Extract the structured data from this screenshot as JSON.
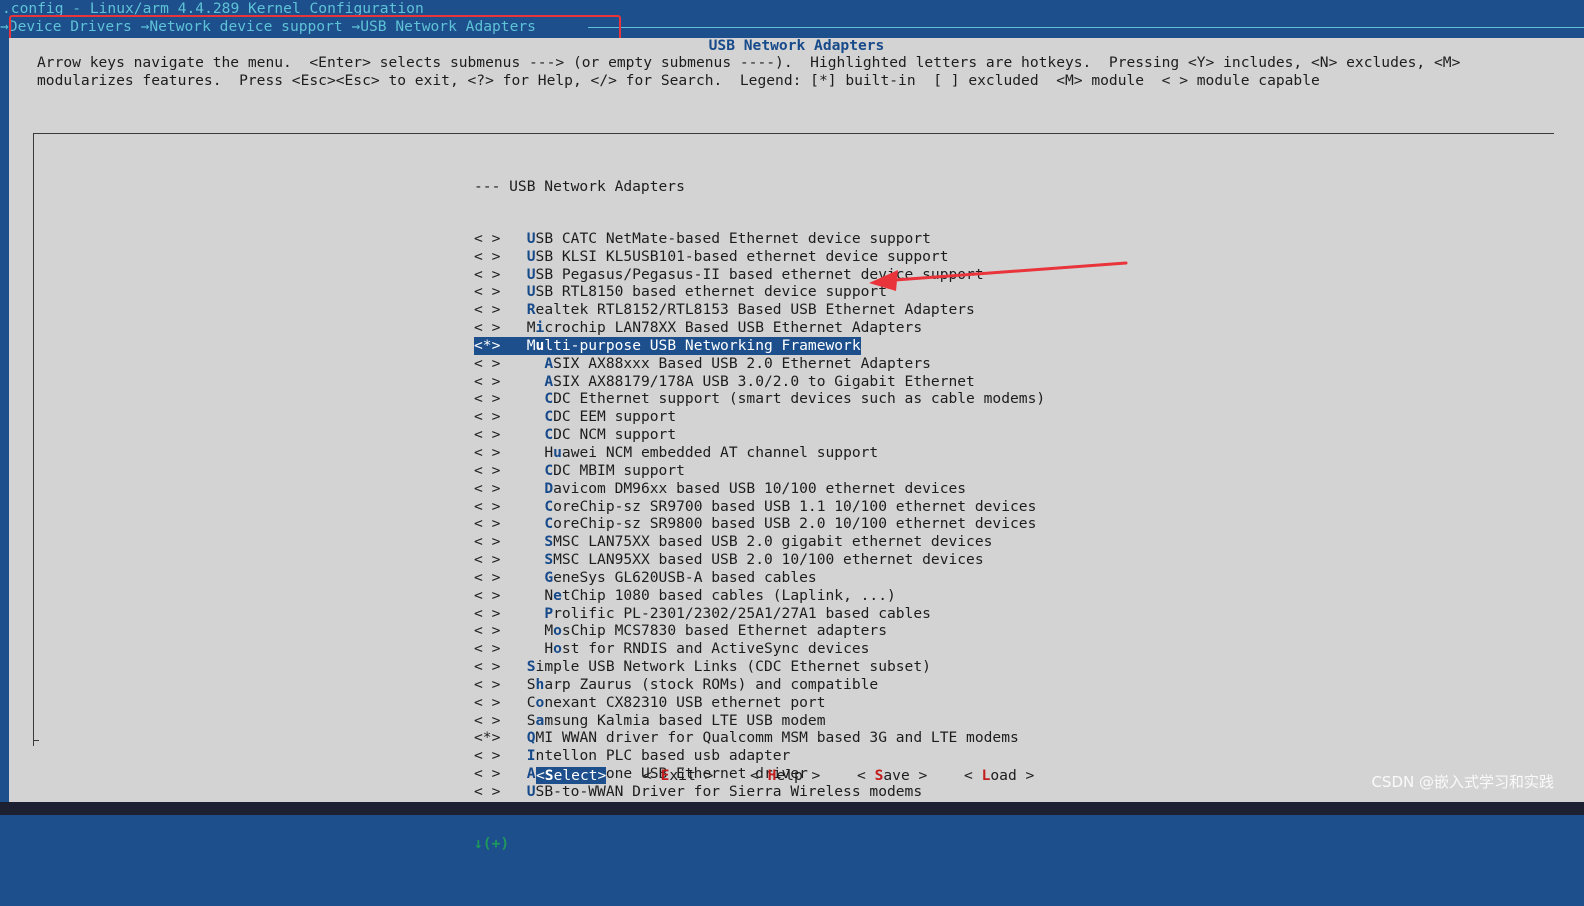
{
  "window": {
    "title": ".config - Linux/arm 4.4.289 Kernel Configuration",
    "breadcrumb": "→Device Drivers →Network device support →USB Network Adapters",
    "annotation_color": "#e8343a"
  },
  "panel": {
    "title": "USB Network Adapters",
    "help_lines": [
      "Arrow keys navigate the menu.  <Enter> selects submenus ---> (or empty submenus ----).  Highlighted letters are hotkeys.  Pressing <Y> includes, <N> excludes, <M>",
      "modularizes features.  Press <Esc><Esc> to exit, <?> for Help, </> for Search.  Legend: [*] built-in  [ ] excluded  <M> module  < > module capable"
    ]
  },
  "menu": {
    "header": "--- USB Network Adapters",
    "items": [
      {
        "state": "< >",
        "indent": "  ",
        "hotkey": "U",
        "rest": "SB CATC NetMate-based Ethernet device support"
      },
      {
        "state": "< >",
        "indent": "  ",
        "hotkey": "U",
        "rest": "SB KLSI KL5USB101-based ethernet device support"
      },
      {
        "state": "< >",
        "indent": "  ",
        "hotkey": "U",
        "rest": "SB Pegasus/Pegasus-II based ethernet device support"
      },
      {
        "state": "< >",
        "indent": "  ",
        "hotkey": "U",
        "rest": "SB RTL8150 based ethernet device support"
      },
      {
        "state": "< >",
        "indent": "  ",
        "hotkey": "R",
        "rest": "ealtek RTL8152/RTL8153 Based USB Ethernet Adapters"
      },
      {
        "state": "< >",
        "indent": "  ",
        "pre": "M",
        "hotkey": "i",
        "rest": "crochip LAN78XX Based USB Ethernet Adapters"
      },
      {
        "state": "<*>",
        "indent": "  ",
        "pre": "M",
        "hotkey": "u",
        "rest": "lti-purpose USB Networking Framework",
        "selected": true
      },
      {
        "state": "< >",
        "indent": "    ",
        "hotkey": "A",
        "rest": "SIX AX88xxx Based USB 2.0 Ethernet Adapters"
      },
      {
        "state": "< >",
        "indent": "    ",
        "hotkey": "A",
        "rest": "SIX AX88179/178A USB 3.0/2.0 to Gigabit Ethernet"
      },
      {
        "state": "< >",
        "indent": "    ",
        "hotkey": "C",
        "rest": "DC Ethernet support (smart devices such as cable modems)"
      },
      {
        "state": "< >",
        "indent": "    ",
        "hotkey": "C",
        "rest": "DC EEM support"
      },
      {
        "state": "< >",
        "indent": "    ",
        "hotkey": "C",
        "rest": "DC NCM support"
      },
      {
        "state": "< >",
        "indent": "    ",
        "pre": "H",
        "hotkey": "u",
        "rest": "awei NCM embedded AT channel support"
      },
      {
        "state": "< >",
        "indent": "    ",
        "hotkey": "C",
        "rest": "DC MBIM support"
      },
      {
        "state": "< >",
        "indent": "    ",
        "hotkey": "D",
        "rest": "avicom DM96xx based USB 10/100 ethernet devices"
      },
      {
        "state": "< >",
        "indent": "    ",
        "hotkey": "C",
        "rest": "oreChip-sz SR9700 based USB 1.1 10/100 ethernet devices"
      },
      {
        "state": "< >",
        "indent": "    ",
        "hotkey": "C",
        "rest": "oreChip-sz SR9800 based USB 2.0 10/100 ethernet devices"
      },
      {
        "state": "< >",
        "indent": "    ",
        "hotkey": "S",
        "rest": "MSC LAN75XX based USB 2.0 gigabit ethernet devices"
      },
      {
        "state": "< >",
        "indent": "    ",
        "hotkey": "S",
        "rest": "MSC LAN95XX based USB 2.0 10/100 ethernet devices"
      },
      {
        "state": "< >",
        "indent": "    ",
        "hotkey": "G",
        "rest": "eneSys GL620USB-A based cables"
      },
      {
        "state": "< >",
        "indent": "    ",
        "pre": "N",
        "hotkey": "e",
        "rest": "tChip 1080 based cables (Laplink, ...)"
      },
      {
        "state": "< >",
        "indent": "    ",
        "hotkey": "P",
        "rest": "rolific PL-2301/2302/25A1/27A1 based cables"
      },
      {
        "state": "< >",
        "indent": "    ",
        "pre": "M",
        "hotkey": "o",
        "rest": "sChip MCS7830 based Ethernet adapters"
      },
      {
        "state": "< >",
        "indent": "    ",
        "pre": "H",
        "hotkey": "o",
        "rest": "st for RNDIS and ActiveSync devices"
      },
      {
        "state": "< >",
        "indent": "  ",
        "hotkey": "S",
        "rest": "imple USB Network Links (CDC Ethernet subset)"
      },
      {
        "state": "< >",
        "indent": "  ",
        "pre": "S",
        "hotkey": "h",
        "rest": "arp Zaurus (stock ROMs) and compatible"
      },
      {
        "state": "< >",
        "indent": "  ",
        "pre": "C",
        "hotkey": "o",
        "rest": "nexant CX82310 USB ethernet port"
      },
      {
        "state": "< >",
        "indent": "  ",
        "pre": "S",
        "hotkey": "a",
        "rest": "msung Kalmia based LTE USB modem"
      },
      {
        "state": "<*>",
        "indent": "  ",
        "hotkey": "Q",
        "rest": "MI WWAN driver for Qualcomm MSM based 3G and LTE modems"
      },
      {
        "state": "< >",
        "indent": "  ",
        "hotkey": "I",
        "rest": "ntellon PLC based usb adapter"
      },
      {
        "state": "< >",
        "indent": "  ",
        "hotkey": "A",
        "rest": "pple iPhone USB Ethernet driver"
      },
      {
        "state": "< >",
        "indent": "  ",
        "hotkey": "U",
        "rest": "SB-to-WWAN Driver for Sierra Wireless modems"
      }
    ],
    "scroll_indicator": "↓(+)"
  },
  "buttons": {
    "select": {
      "open": "<",
      "hotkey": "S",
      "rest": "elect",
      "close": ">"
    },
    "exit": {
      "open": "< ",
      "hotkey": "E",
      "rest": "xit",
      "close": " >"
    },
    "help": {
      "open": "< ",
      "hotkey": "H",
      "rest": "elp",
      "close": " >"
    },
    "save": {
      "open": "< ",
      "hotkey": "S",
      "rest": "ave",
      "close": " >"
    },
    "load": {
      "open": "< ",
      "hotkey": "L",
      "rest": "oad",
      "close": " >"
    }
  },
  "watermark": "CSDN @嵌入式学习和实践"
}
